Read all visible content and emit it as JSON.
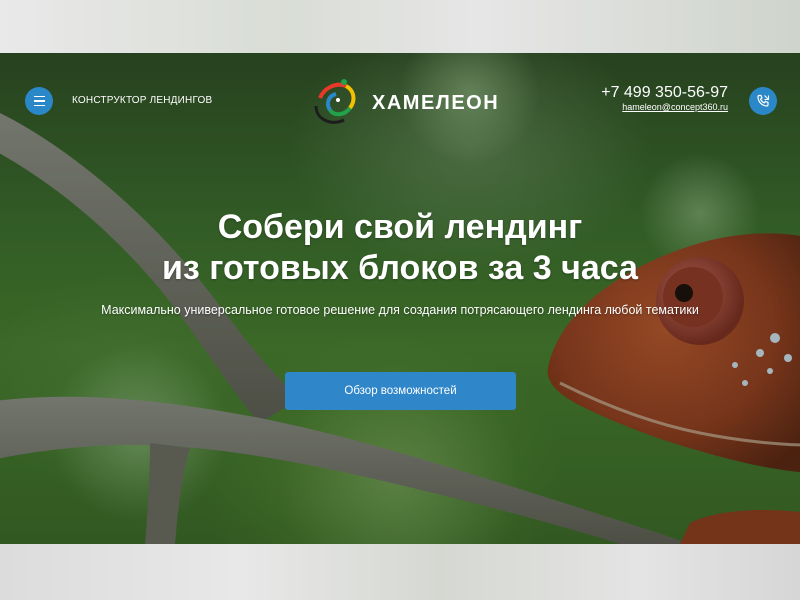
{
  "header": {
    "constructor_label": "Конструктор лендингов",
    "logo_text": "ХАМЕЛЕОН",
    "phone": "+7 499 350-56-97",
    "email": "hameleon@concept360.ru"
  },
  "hero": {
    "headline_line1": "Собери свой лендинг",
    "headline_line2": "из готовых блоков за 3 часа",
    "subtitle": "Максимально универсальное готовое решение для создания потрясающего лендинга любой тематики",
    "cta_label": "Обзор возможностей"
  },
  "icons": {
    "menu": "hamburger-icon",
    "call": "phone-icon",
    "logo": "chameleon-logo-icon"
  },
  "colors": {
    "accent": "#2b88c8",
    "button": "#2f86c9",
    "text": "#ffffff"
  }
}
